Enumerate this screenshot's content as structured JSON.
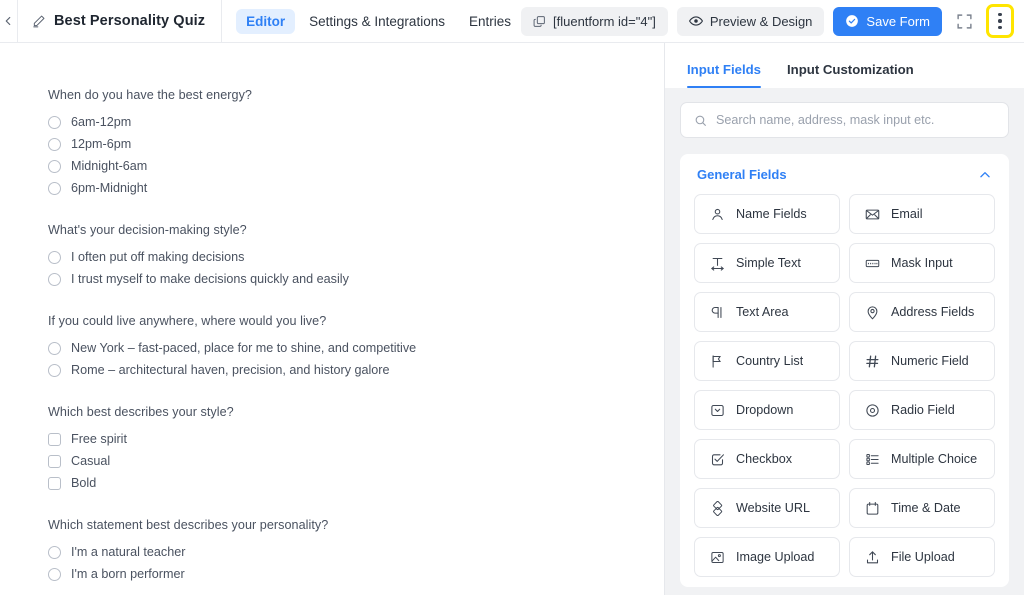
{
  "header": {
    "back_icon": "chevron-left-icon",
    "edit_icon": "pencil-icon",
    "form_title": "Best Personality Quiz",
    "tabs": [
      {
        "label": "Editor",
        "active": true
      },
      {
        "label": "Settings & Integrations",
        "active": false
      },
      {
        "label": "Entries",
        "active": false
      }
    ],
    "shortcode": {
      "label": "[fluentform id=\"4\"]",
      "icon": "copy-icon"
    },
    "preview": {
      "label": "Preview & Design",
      "icon": "eye-icon"
    },
    "save": {
      "label": "Save Form",
      "icon": "check-circle-icon",
      "color": "#2f80f5"
    },
    "fullscreen_icon": "fullscreen-expand-icon",
    "more_icon": "kebab-menu-icon",
    "highlight_color": "#ffe500"
  },
  "canvas": {
    "questions": [
      {
        "label": "When do you have the best energy?",
        "type": "radio",
        "options": [
          "6am-12pm",
          "12pm-6pm",
          "Midnight-6am",
          "6pm-Midnight"
        ]
      },
      {
        "label": "What's your decision-making style?",
        "type": "radio",
        "options": [
          "I often put off making decisions",
          "I trust myself to make decisions quickly and easily"
        ]
      },
      {
        "label": "If you could live anywhere, where would you live?",
        "type": "radio",
        "options": [
          "New York – fast-paced, place for me to shine, and competitive",
          "Rome – architectural haven, precision, and history galore"
        ]
      },
      {
        "label": "Which best describes your style?",
        "type": "checkbox",
        "options": [
          "Free spirit",
          "Casual",
          "Bold"
        ]
      },
      {
        "label": "Which statement best describes your personality?",
        "type": "radio",
        "options": [
          "I'm a natural teacher",
          "I'm a born performer"
        ]
      }
    ]
  },
  "sidebar": {
    "tabs": [
      {
        "label": "Input Fields",
        "active": true
      },
      {
        "label": "Input Customization",
        "active": false
      }
    ],
    "search": {
      "placeholder": "Search name, address, mask input etc.",
      "value": "",
      "icon": "search-icon"
    },
    "panel": {
      "title": "General Fields",
      "collapse_icon": "chevron-up-icon",
      "accent": "#2f80f5",
      "fields": [
        {
          "label": "Name Fields",
          "icon": "user-icon"
        },
        {
          "label": "Email",
          "icon": "envelope-icon"
        },
        {
          "label": "Simple Text",
          "icon": "text-width-icon"
        },
        {
          "label": "Mask Input",
          "icon": "mask-input-icon"
        },
        {
          "label": "Text Area",
          "icon": "paragraph-icon"
        },
        {
          "label": "Address Fields",
          "icon": "map-pin-icon"
        },
        {
          "label": "Country List",
          "icon": "flag-icon"
        },
        {
          "label": "Numeric Field",
          "icon": "hash-icon"
        },
        {
          "label": "Dropdown",
          "icon": "dropdown-icon"
        },
        {
          "label": "Radio Field",
          "icon": "radio-circle-icon"
        },
        {
          "label": "Checkbox",
          "icon": "checkbox-check-icon"
        },
        {
          "label": "Multiple Choice",
          "icon": "list-choice-icon"
        },
        {
          "label": "Website URL",
          "icon": "link-diamond-icon"
        },
        {
          "label": "Time & Date",
          "icon": "calendar-icon"
        },
        {
          "label": "Image Upload",
          "icon": "image-icon"
        },
        {
          "label": "File Upload",
          "icon": "upload-icon"
        }
      ]
    }
  }
}
